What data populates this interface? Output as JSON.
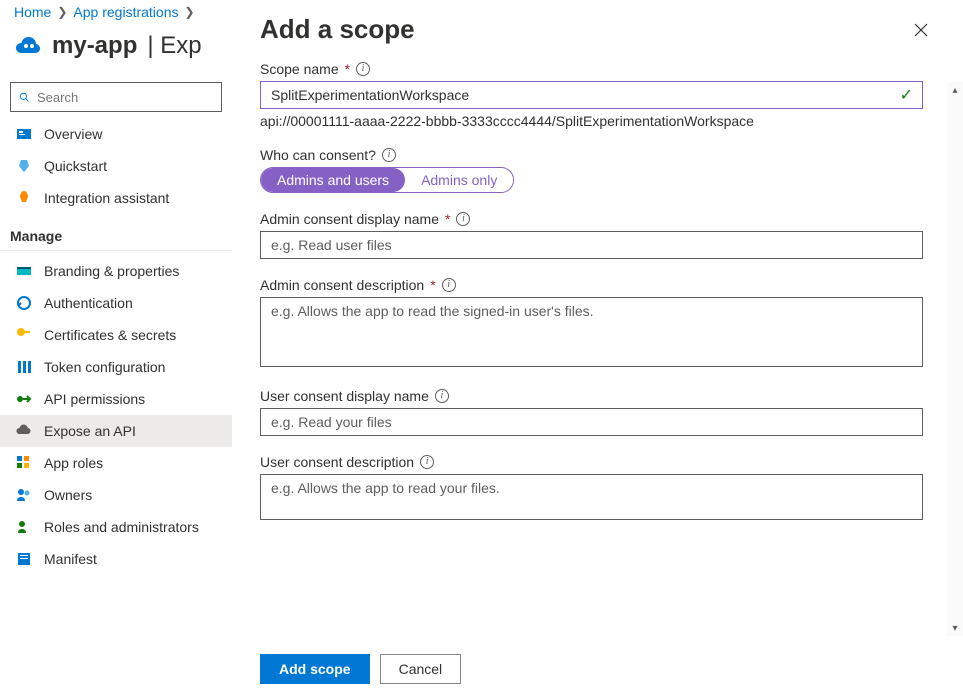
{
  "breadcrumb": {
    "home": "Home",
    "appreg": "App registrations"
  },
  "header": {
    "app_name": "my-app",
    "page_name": "Expose an API"
  },
  "sidebar": {
    "search_placeholder": "Search",
    "top": [
      {
        "label": "Overview"
      },
      {
        "label": "Quickstart"
      },
      {
        "label": "Integration assistant"
      }
    ],
    "manage_header": "Manage",
    "manage": [
      {
        "label": "Branding & properties"
      },
      {
        "label": "Authentication"
      },
      {
        "label": "Certificates & secrets"
      },
      {
        "label": "Token configuration"
      },
      {
        "label": "API permissions"
      },
      {
        "label": "Expose an API"
      },
      {
        "label": "App roles"
      },
      {
        "label": "Owners"
      },
      {
        "label": "Roles and administrators"
      },
      {
        "label": "Manifest"
      }
    ]
  },
  "panel": {
    "title": "Add a scope",
    "scope_name_label": "Scope name",
    "scope_name_value": "SplitExperimentationWorkspace",
    "scope_uri": "api://00001111-aaaa-2222-bbbb-3333cccc4444/SplitExperimentationWorkspace",
    "consent_label": "Who can consent?",
    "consent_options": {
      "both": "Admins and users",
      "admins": "Admins only"
    },
    "admin_display_label": "Admin consent display name",
    "admin_display_placeholder": "e.g. Read user files",
    "admin_desc_label": "Admin consent description",
    "admin_desc_placeholder": "e.g. Allows the app to read the signed-in user's files.",
    "user_display_label": "User consent display name",
    "user_display_placeholder": "e.g. Read your files",
    "user_desc_label": "User consent description",
    "user_desc_placeholder": "e.g. Allows the app to read your files.",
    "footer": {
      "add": "Add scope",
      "cancel": "Cancel"
    }
  }
}
